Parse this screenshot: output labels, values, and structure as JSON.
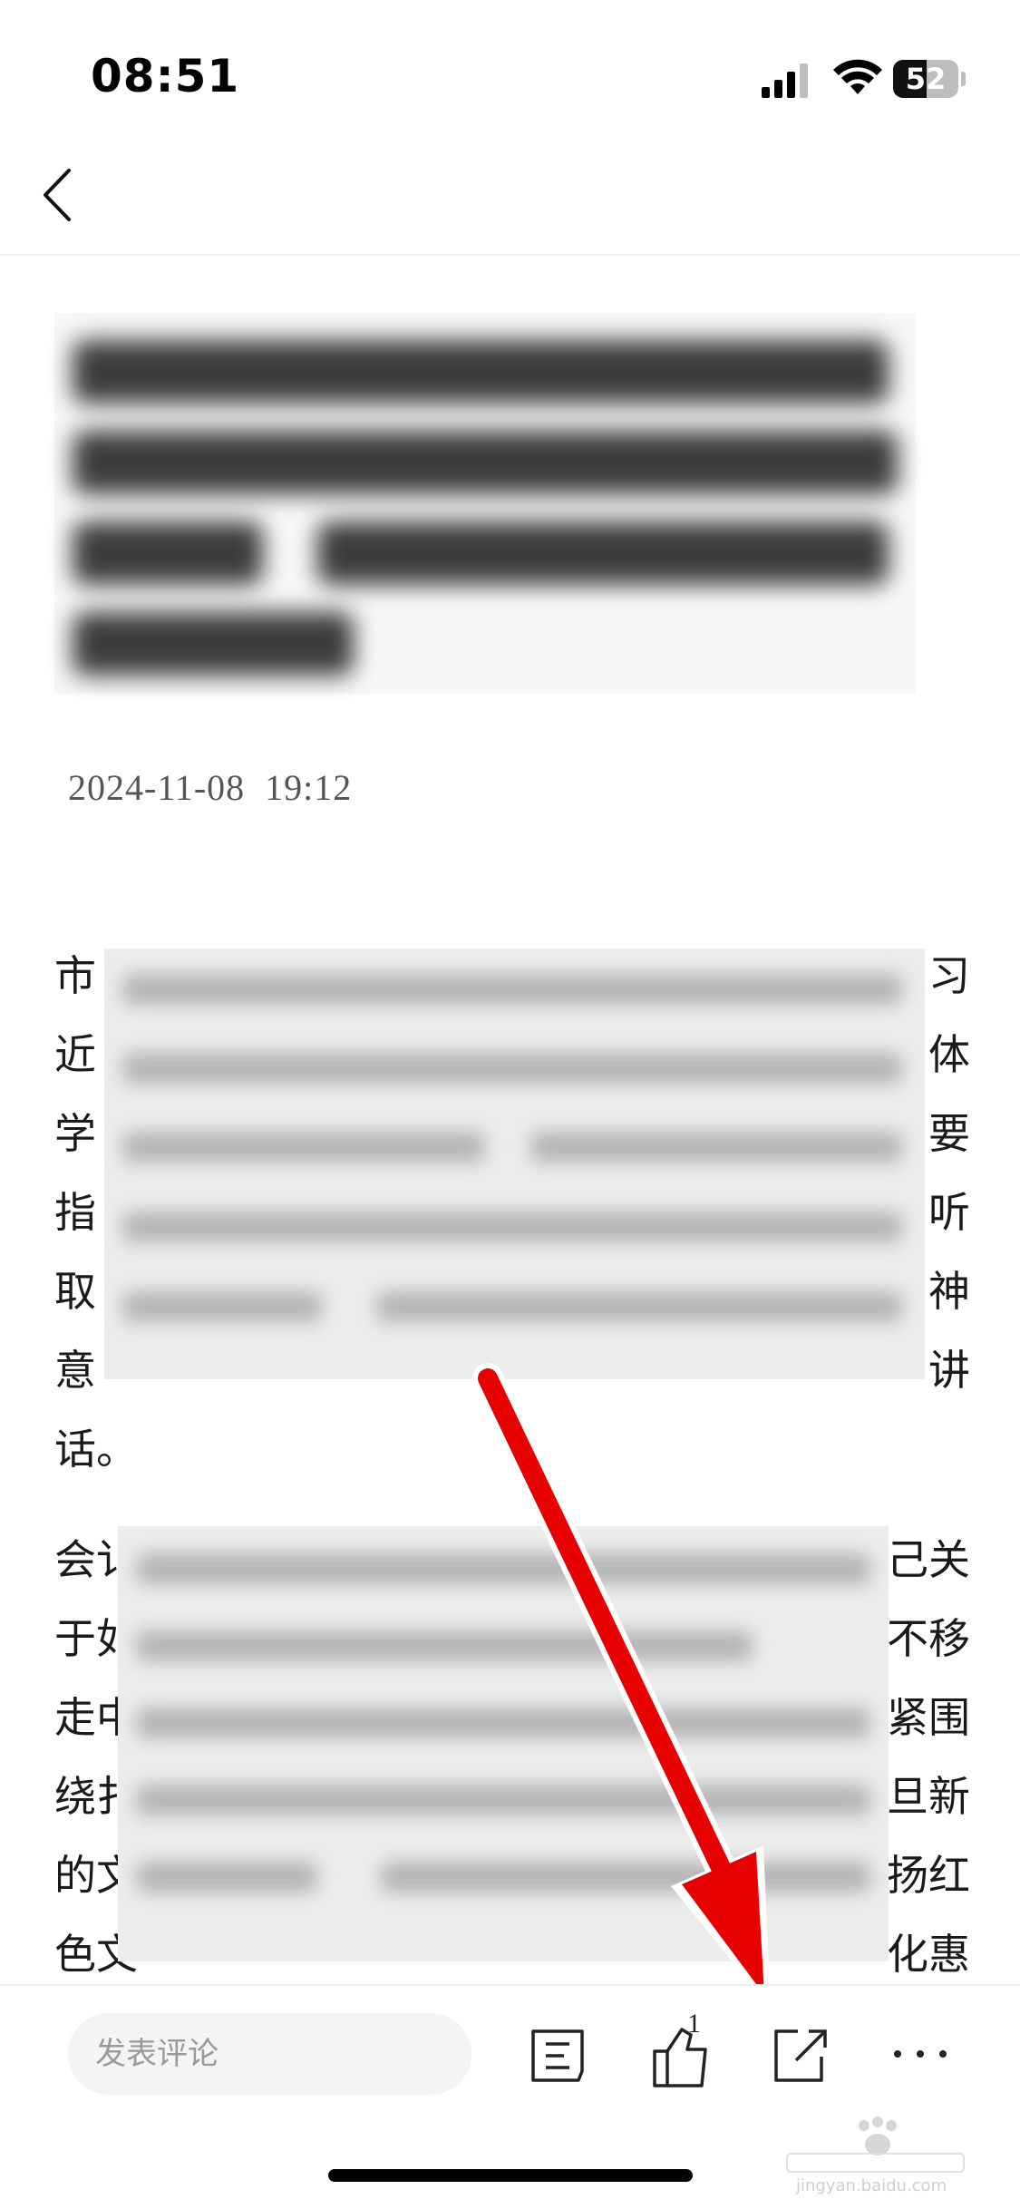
{
  "status_bar": {
    "time": "08:51",
    "battery_level": "52",
    "icons": [
      "signal-icon",
      "wifi-icon",
      "battery-icon"
    ]
  },
  "nav": {
    "back_icon": "chevron-left-icon"
  },
  "article": {
    "date": "2024-11-08  19:12",
    "paragraph1": {
      "lines": [
        {
          "start": "市",
          "end": "习"
        },
        {
          "start": "近",
          "end": "体"
        },
        {
          "start": "学",
          "end": "要"
        },
        {
          "start": "指",
          "end": "听"
        },
        {
          "start": "取",
          "end": "神"
        },
        {
          "start": "意",
          "end": "讲"
        },
        {
          "start": "话。",
          "end": ""
        }
      ]
    },
    "paragraph2": {
      "lines": [
        {
          "start": "会讠",
          "end": "己关"
        },
        {
          "start": "于如",
          "end": "不移"
        },
        {
          "start": "走中",
          "end": "紧围"
        },
        {
          "start": "绕扌",
          "end": "旦新"
        },
        {
          "start": "的文",
          "end": "扬红"
        },
        {
          "start": "色文",
          "end": "化惠"
        }
      ]
    }
  },
  "bottom_bar": {
    "comment_placeholder": "发表评论",
    "like_count": "1",
    "icons": [
      "comments-icon",
      "thumbs-up-icon",
      "share-icon",
      "more-icon"
    ]
  },
  "watermark": {
    "text": "jingyan.baidu.com"
  },
  "colors": {
    "annotation_arrow": "#e60000",
    "text": "#1a1a1a",
    "date": "#555555"
  }
}
